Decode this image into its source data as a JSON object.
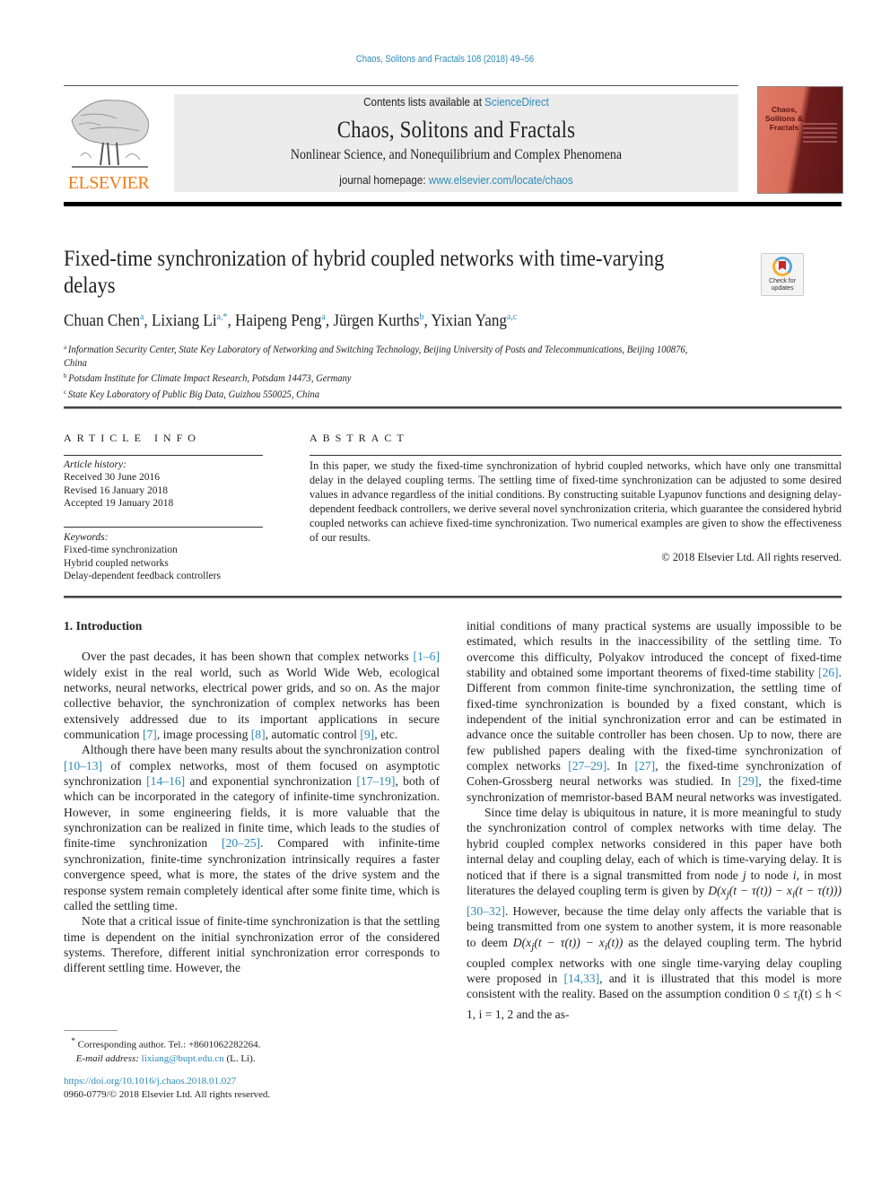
{
  "header": {
    "citation": "Chaos, Solitons and Fractals 108 (2018) 49–56",
    "contents_prefix": "Contents lists available at ",
    "contents_link": "ScienceDirect",
    "journal_name": "Chaos, Solitons and Fractals",
    "journal_subtitle": "Nonlinear Science, and Nonequilibrium and Complex Phenomena",
    "homepage_prefix": "journal homepage: ",
    "homepage_link": "www.elsevier.com/locate/chaos",
    "publisher_logo_text": "ELSEVIER",
    "cover_title": "Chaos, Solitons & Fractals",
    "check_updates": "Check for updates",
    "brand_color": "#f07d19",
    "link_color": "#2a8ab8"
  },
  "article": {
    "title": "Fixed-time synchronization of hybrid coupled networks with time-varying delays",
    "authors": [
      {
        "name": "Chuan Chen",
        "sup": "a"
      },
      {
        "name": "Lixiang Li",
        "sup": "a,*"
      },
      {
        "name": "Haipeng Peng",
        "sup": "a"
      },
      {
        "name": "Jürgen Kurths",
        "sup": "b"
      },
      {
        "name": "Yixian Yang",
        "sup": "a,c"
      }
    ],
    "affiliations": [
      {
        "mark": "a",
        "text": "Information Security Center, State Key Laboratory of Networking and Switching Technology, Beijing University of Posts and Telecommunications, Beijing 100876, China"
      },
      {
        "mark": "b",
        "text": "Potsdam Institute for Climate Impact Research, Potsdam 14473, Germany"
      },
      {
        "mark": "c",
        "text": "State Key Laboratory of Public Big Data, Guizhou 550025, China"
      }
    ]
  },
  "article_info": {
    "label": "ARTICLE INFO",
    "history_label": "Article history:",
    "history": [
      "Received 30 June 2016",
      "Revised 16 January 2018",
      "Accepted 19 January 2018"
    ],
    "keywords_label": "Keywords:",
    "keywords": [
      "Fixed-time synchronization",
      "Hybrid coupled networks",
      "Delay-dependent feedback controllers"
    ]
  },
  "abstract": {
    "label": "ABSTRACT",
    "text": "In this paper, we study the fixed-time synchronization of hybrid coupled networks, which have only one transmittal delay in the delayed coupling terms. The settling time of fixed-time synchronization can be adjusted to some desired values in advance regardless of the initial conditions. By constructing suitable Lyapunov functions and designing delay-dependent feedback controllers, we derive several novel synchronization criteria, which guarantee the considered hybrid coupled networks can achieve fixed-time synchronization. Two numerical examples are given to show the effectiveness of our results.",
    "copyright": "© 2018 Elsevier Ltd. All rights reserved."
  },
  "body": {
    "section_heading": "1. Introduction",
    "left": {
      "p1": [
        "Over the past decades, it has been shown that complex networks ",
        "[1–6]",
        " widely exist in the real world, such as World Wide Web, ecological networks, neural networks, electrical power grids, and so on. As the major collective behavior, the synchronization of complex networks has been extensively addressed due to its important applications in secure communication ",
        "[7]",
        ", image processing ",
        "[8]",
        ", automatic control ",
        "[9]",
        ", etc."
      ],
      "p2": [
        "Although there have been many results about the synchronization control ",
        "[10–13]",
        " of complex networks, most of them focused on asymptotic synchronization ",
        "[14–16]",
        " and exponential synchronization ",
        "[17–19]",
        ", both of which can be incorporated in the category of infinite-time synchronization. However, in some engineering fields, it is more valuable that the synchronization can be realized in finite time, which leads to the studies of finite-time synchronization ",
        "[20–25]",
        ". Compared with infinite-time synchronization, finite-time synchronization intrinsically requires a faster convergence speed, what is more, the states of the drive system and the response system remain completely identical after some finite time, which is called the settling time."
      ],
      "p3": "Note that a critical issue of finite-time synchronization is that the settling time is dependent on the initial synchronization error of the considered systems. Therefore, different initial synchronization error corresponds to different settling time. However, the"
    },
    "right": {
      "p1": [
        "initial conditions of many practical systems are usually impossible to be estimated, which results in the inaccessibility of the settling time. To overcome this difficulty, Polyakov introduced the concept of fixed-time stability and obtained some important theorems of fixed-time stability ",
        "[26]",
        ". Different from common finite-time synchronization, the settling time of fixed-time synchronization is bounded by a fixed constant, which is independent of the initial synchronization error and can be estimated in advance once the suitable controller has been chosen. Up to now, there are few published papers dealing with the fixed-time synchronization of complex networks ",
        "[27–29]",
        ". In ",
        "[27]",
        ", the fixed-time synchronization of Cohen-Grossberg neural networks was studied. In ",
        "[29]",
        ", the fixed-time synchronization of memristor-based BAM neural networks was investigated."
      ],
      "p2": [
        "Since time delay is ubiquitous in nature, it is more meaningful to study the synchronization control of complex networks with time delay. The hybrid coupled complex networks considered in this paper have both internal delay and coupling delay, each of which is time-varying delay. It is noticed that if there is a signal transmitted from node ",
        "j",
        " to node ",
        "i",
        ", in most literatures the delayed coupling term is given by ",
        "D(x",
        "j",
        "(t − τ(t)) − x",
        "i",
        "(t − τ(t)))",
        " ",
        "[30–32]",
        ". However, because the time delay only affects the variable that is being transmitted from one system to another system, it is more reasonable to deem ",
        "D(x",
        "j",
        "(t − τ(t)) − x",
        "i",
        "(t))",
        " as the delayed coupling term. The hybrid coupled complex networks with one single time-varying delay coupling were proposed in ",
        "[14,33]",
        ", and it is illustrated that this model is more consistent with the reality. Based on the assumption condition 0 ≤ ",
        "τ̇",
        "i",
        "(t) ≤ h < 1,  i = 1, 2 and the as-"
      ]
    }
  },
  "footnote": {
    "mark": "*",
    "corresponding": "Corresponding author. Tel.: +8601062282264.",
    "email_label": "E-mail address:",
    "email": "lixiang@bupt.edu.cn",
    "email_suffix": " (L. Li).",
    "doi": "https://doi.org/10.1016/j.chaos.2018.01.027",
    "issn_copyright": "0960-0779/© 2018 Elsevier Ltd. All rights reserved."
  }
}
